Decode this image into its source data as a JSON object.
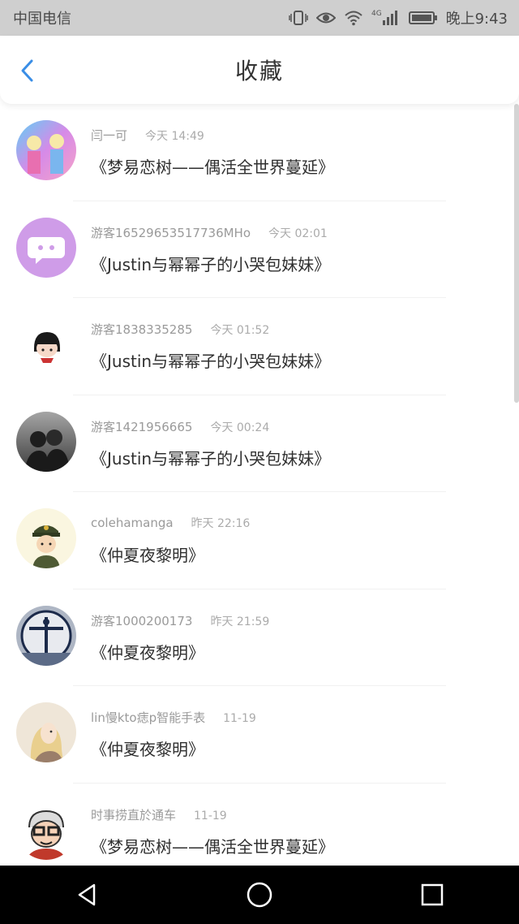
{
  "status": {
    "carrier": "中国电信",
    "time": "晚上9:43",
    "network": "4G"
  },
  "header": {
    "title": "收藏"
  },
  "items": [
    {
      "user": "闫一可",
      "time": "今天 14:49",
      "work": "《梦易恋树——偶活全世界蔓延》"
    },
    {
      "user": "游客16529653517736MHo",
      "time": "今天 02:01",
      "work": "《Justin与幂幂子的小哭包妹妹》"
    },
    {
      "user": "游客1838335285",
      "time": "今天 01:52",
      "work": "《Justin与幂幂子的小哭包妹妹》"
    },
    {
      "user": "游客1421956665",
      "time": "今天 00:24",
      "work": "《Justin与幂幂子的小哭包妹妹》"
    },
    {
      "user": "colehamanga",
      "time": "昨天 22:16",
      "work": "《仲夏夜黎明》"
    },
    {
      "user": "游客1000200173",
      "time": "昨天 21:59",
      "work": "《仲夏夜黎明》"
    },
    {
      "user": "lin慢kto痣p智能手表",
      "time": "11-19",
      "work": "《仲夏夜黎明》"
    },
    {
      "user": "时事捞直於通车",
      "time": "11-19",
      "work": "《梦易恋树——偶活全世界蔓延》"
    }
  ],
  "colors": {
    "accent": "#3a8ee6",
    "statusbar": "#cfcfcf",
    "navbar": "#000000"
  },
  "icons": {
    "back": "chevron-left-icon",
    "nav": [
      "back-triangle-icon",
      "home-circle-icon",
      "recents-square-icon"
    ]
  }
}
